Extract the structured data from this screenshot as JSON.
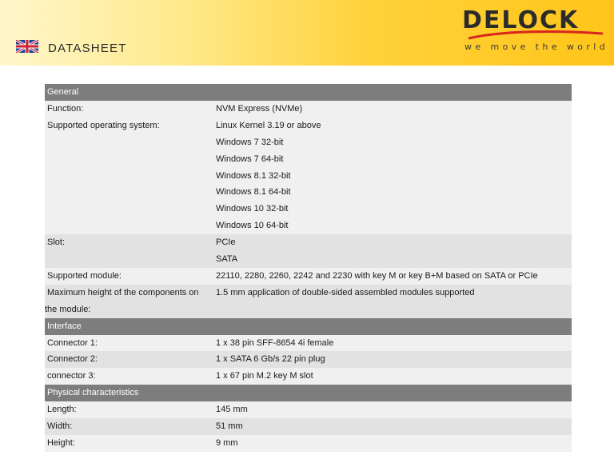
{
  "header": {
    "doc_title": "DATASHEET",
    "brand": "DELOCK",
    "tagline": "we move the world",
    "flag_icon": "uk-flag-icon"
  },
  "colors": {
    "section_bar": "#7d7d7d",
    "row_light": "#f0f0f0",
    "row_dark": "#e2e2e2",
    "logo_red": "#d9251d"
  },
  "sections": [
    {
      "title": "General",
      "rows": [
        {
          "key": [
            "Function:"
          ],
          "values": [
            "NVM Express (NVMe)"
          ]
        },
        {
          "key": [
            "Supported operating system:"
          ],
          "values": [
            "Linux Kernel 3.19 or above",
            "Windows 7 32-bit",
            "Windows 7 64-bit",
            "Windows 8.1 32-bit",
            "Windows 8.1 64-bit",
            "Windows 10 32-bit",
            "Windows 10 64-bit"
          ]
        },
        {
          "key": [
            "Slot:"
          ],
          "values": [
            "PCIe",
            "SATA"
          ]
        },
        {
          "key": [
            "Supported module:"
          ],
          "values": [
            "22110, 2280, 2260, 2242 and 2230 with key M or key B+M based on SATA or PCIe"
          ]
        },
        {
          "key": [
            " Maximum height of the components on",
            "the module:"
          ],
          "values": [
            "1.5 mm application of double-sided assembled modules supported"
          ]
        }
      ]
    },
    {
      "title": "Interface",
      "rows": [
        {
          "key": [
            "Connector 1:"
          ],
          "values": [
            "1 x 38 pin SFF-8654 4i female"
          ]
        },
        {
          "key": [
            "Connector 2:"
          ],
          "values": [
            "1 x SATA 6 Gb/s 22 pin plug"
          ]
        },
        {
          "key": [
            "connector 3:"
          ],
          "values": [
            "1 x 67 pin M.2 key M slot"
          ]
        }
      ]
    },
    {
      "title": "Physical characteristics",
      "rows": [
        {
          "key": [
            "Length:"
          ],
          "values": [
            "145 mm"
          ]
        },
        {
          "key": [
            "Width:"
          ],
          "values": [
            "51 mm"
          ]
        },
        {
          "key": [
            "Height:"
          ],
          "values": [
            "9 mm"
          ]
        }
      ]
    }
  ]
}
